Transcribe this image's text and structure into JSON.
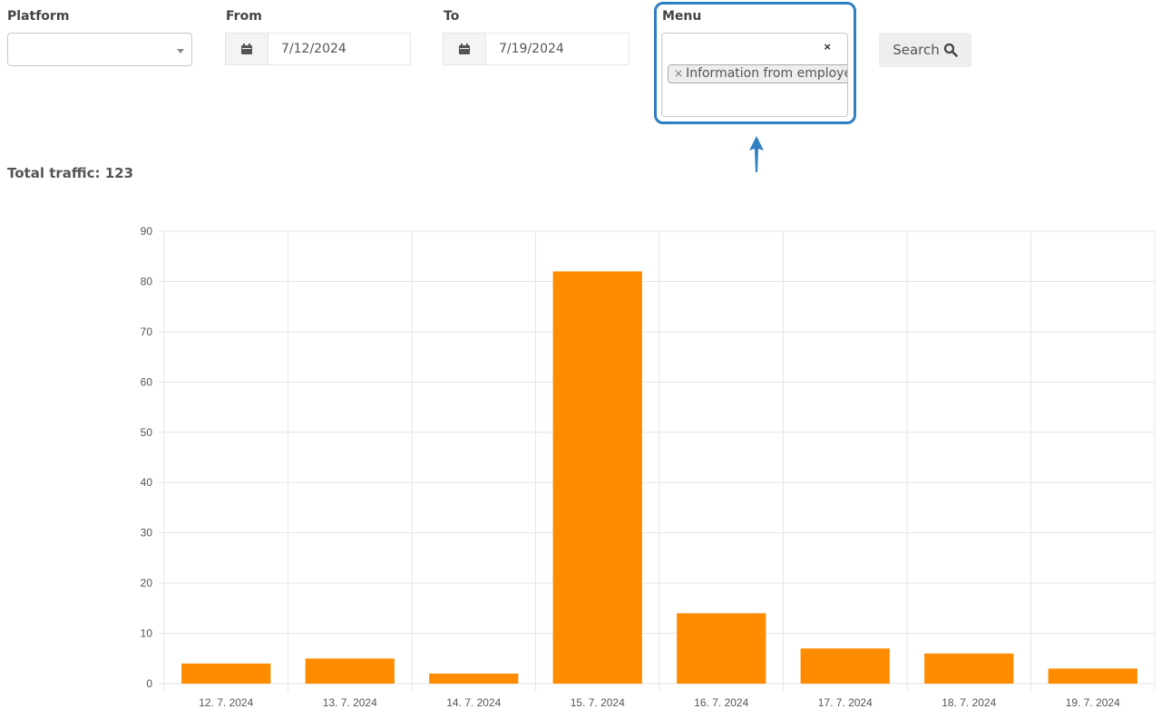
{
  "filters": {
    "platform": {
      "label": "Platform",
      "value": ""
    },
    "from": {
      "label": "From",
      "value": "7/12/2024"
    },
    "to": {
      "label": "To",
      "value": "7/19/2024"
    },
    "menu": {
      "label": "Menu",
      "clear_icon": "×",
      "selected": [
        "Information from employe"
      ]
    },
    "search_label": "Search"
  },
  "summary": {
    "label": "Total traffic:",
    "value": "123"
  },
  "colors": {
    "bar": "#ff8c00",
    "highlight": "#2f7fc1",
    "grid": "#e5e5e5"
  },
  "icons": [
    "calendar-icon",
    "search-icon",
    "chevron-down-icon",
    "remove-chip-icon",
    "arrow-up-icon"
  ],
  "chart_data": {
    "type": "bar",
    "title": "",
    "xlabel": "",
    "ylabel": "",
    "categories": [
      "12. 7. 2024",
      "13. 7. 2024",
      "14. 7. 2024",
      "15. 7. 2024",
      "16. 7. 2024",
      "17. 7. 2024",
      "18. 7. 2024",
      "19. 7. 2024"
    ],
    "values": [
      4,
      5,
      2,
      82,
      14,
      7,
      6,
      3
    ],
    "ylim": [
      0,
      90
    ],
    "yticks": [
      0,
      10,
      20,
      30,
      40,
      50,
      60,
      70,
      80,
      90
    ],
    "grid": true,
    "legend": "none"
  }
}
